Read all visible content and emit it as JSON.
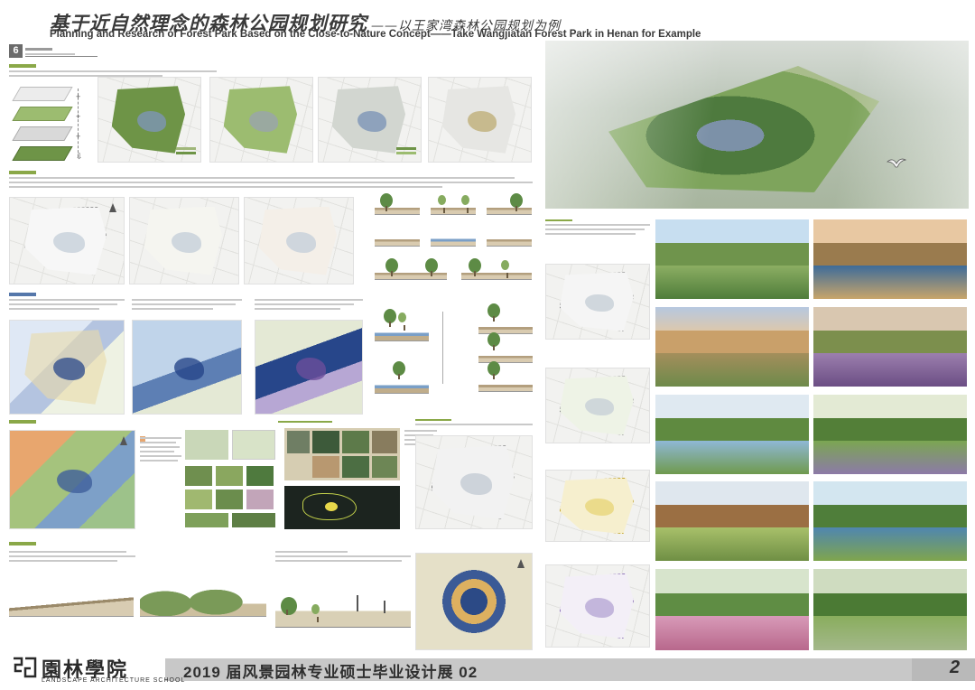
{
  "header": {
    "title_cn": "基于近自然理念的森林公园规划研究",
    "title_cn_sub": "——以王家湾森林公园规划为例",
    "title_en": "Planning and Research of Forest Park Based on the Close-to-Nature Concept——Take Wangjiatan Forest Park in Henan for Example"
  },
  "section": {
    "number": "6"
  },
  "footer": {
    "logo_text": "園林學院",
    "logo_en": "LANDSCAPE ARCHITECTURE SCHOOL",
    "exhibition": "2019 届风景园林专业硕士毕业设计展",
    "exhibition_no": "02",
    "page_number": "2"
  },
  "colors": {
    "forest_green": "#6e9447",
    "light_green": "#9cbc70",
    "water_blue": "#5d7fb4",
    "label_green": "#8aa848",
    "footer_band": "#c8c8c8"
  }
}
